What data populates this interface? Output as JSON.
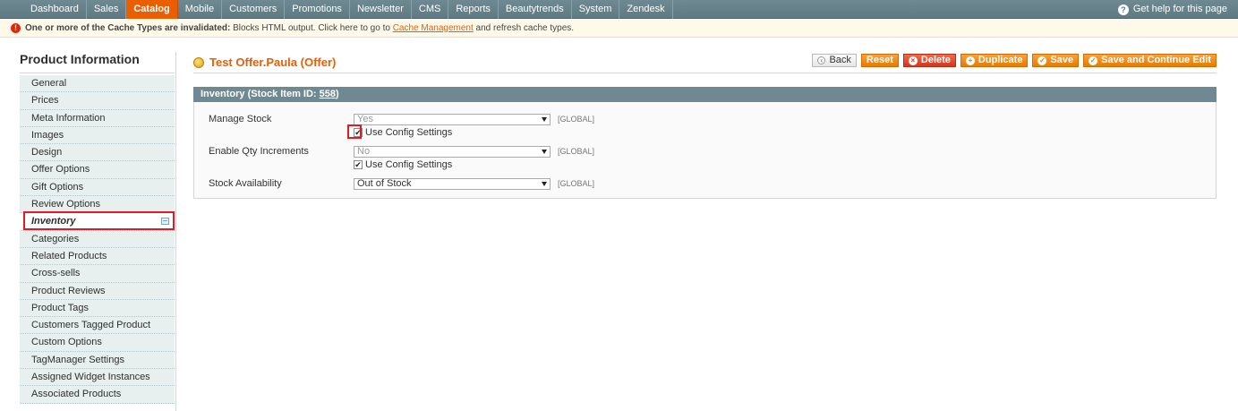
{
  "nav": {
    "items": [
      "Dashboard",
      "Sales",
      "Catalog",
      "Mobile",
      "Customers",
      "Promotions",
      "Newsletter",
      "CMS",
      "Reports",
      "Beautytrends",
      "System",
      "Zendesk"
    ],
    "active": "Catalog",
    "help_label": "Get help for this page"
  },
  "notice": {
    "bold": "One or more of the Cache Types are invalidated:",
    "text": " Blocks HTML output. Click here to go to ",
    "link": "Cache Management",
    "tail": " and refresh cache types."
  },
  "sidebar": {
    "title": "Product Information",
    "tabs": [
      "General",
      "Prices",
      "Meta Information",
      "Images",
      "Design",
      "Offer Options",
      "Gift Options",
      "Review Options",
      "Inventory",
      "Categories",
      "Related Products",
      "Cross-sells",
      "Product Reviews",
      "Product Tags",
      "Customers Tagged Product",
      "Custom Options",
      "TagManager Settings",
      "Assigned Widget Instances",
      "Associated Products"
    ],
    "active_tab": "Inventory"
  },
  "header": {
    "title": "Test Offer.Paula (Offer)",
    "buttons": {
      "back": "Back",
      "reset": "Reset",
      "delete": "Delete",
      "duplicate": "Duplicate",
      "save": "Save",
      "save_continue": "Save and Continue Edit"
    }
  },
  "inventory": {
    "heading": "Inventory (Stock Item ID: ",
    "stock_item_id": "558",
    "heading_close": ")",
    "rows": [
      {
        "label": "Manage Stock",
        "value": "Yes",
        "scope": "[GLOBAL]",
        "use_config": "Use Config Settings",
        "checked": true
      },
      {
        "label": "Enable Qty Increments",
        "value": "No",
        "scope": "[GLOBAL]",
        "use_config": "Use Config Settings",
        "checked": true
      },
      {
        "label": "Stock Availability",
        "value": "Out of Stock",
        "scope": "[GLOBAL]"
      }
    ]
  },
  "colors": {
    "accent": "#eb5e00",
    "nav_bg": "#6f8992",
    "highlight": "#e01b24"
  }
}
